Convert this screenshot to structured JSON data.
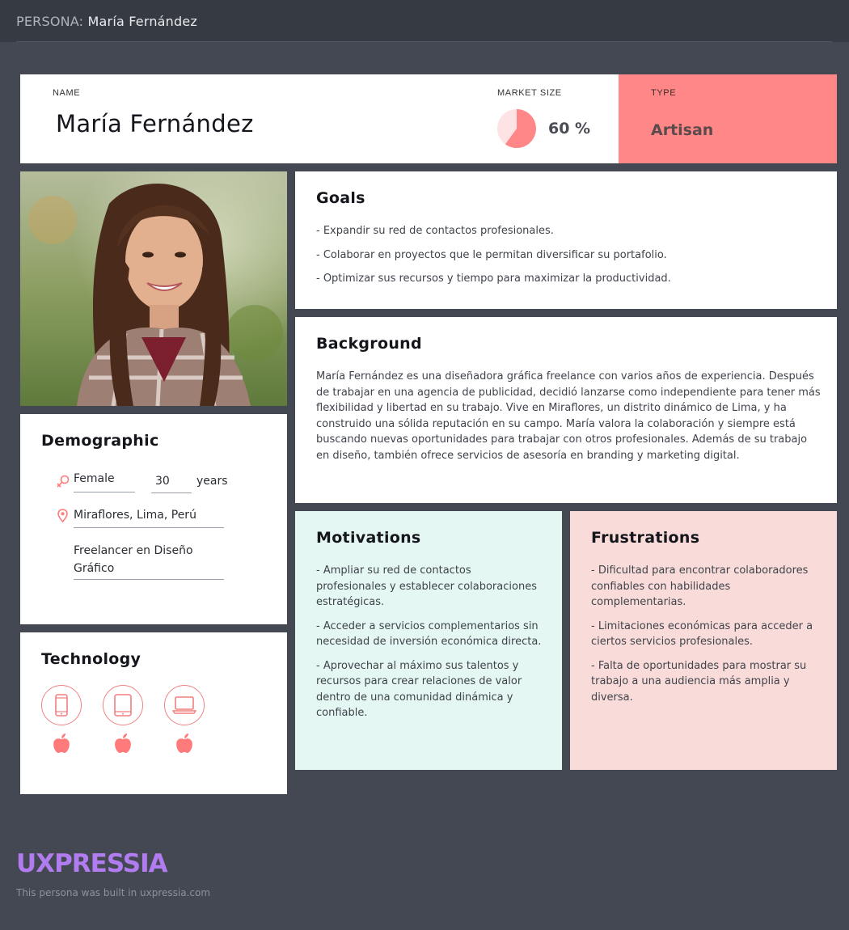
{
  "topbar": {
    "prefix": "PERSONA:",
    "name": "María Fernández"
  },
  "header": {
    "name_label": "NAME",
    "name": "María Fernández",
    "market_label": "MARKET SIZE",
    "market_value": "60 %",
    "market_fraction": 0.6,
    "type_label": "TYPE",
    "type_value": "Artisan"
  },
  "goals": {
    "title": "Goals",
    "items": [
      "- Expandir su red de contactos profesionales.",
      "- Colaborar en proyectos que le permitan diversificar su portafolio.",
      "- Optimizar sus recursos y tiempo para maximizar la productividad."
    ]
  },
  "background": {
    "title": "Background",
    "text": "María Fernández es una diseñadora gráfica freelance con varios años de experiencia. Después de trabajar en una agencia de publicidad, decidió lanzarse como independiente para tener más flexibilidad y libertad en su trabajo. Vive en Miraflores, un distrito dinámico de Lima, y ha construido una sólida reputación en su campo. María valora la colaboración y siempre está buscando nuevas oportunidades para trabajar con otros profesionales. Además de su trabajo en diseño, también ofrece servicios de asesoría en branding y marketing digital."
  },
  "demographic": {
    "title": "Demographic",
    "gender": "Female",
    "age": "30",
    "age_unit": "years",
    "location": "Miraflores, Lima, Perú",
    "occupation": "Freelancer en Diseño Gráfico"
  },
  "technology": {
    "title": "Technology",
    "devices": [
      "phone-icon",
      "tablet-icon",
      "laptop-icon"
    ],
    "platform": "apple-icon"
  },
  "motivations": {
    "title": "Motivations",
    "items": [
      "- Ampliar su red de contactos profesionales y establecer colaboraciones estratégicas.",
      "- Acceder a servicios complementarios sin necesidad de inversión económica directa.",
      "- Aprovechar al máximo sus talentos y recursos para crear relaciones de valor dentro de una comunidad dinámica y confiable."
    ]
  },
  "frustrations": {
    "title": "Frustrations",
    "items": [
      "- Dificultad para encontrar colaboradores confiables con habilidades complementarias.",
      "- Limitaciones económicas para acceder a ciertos servicios profesionales.",
      "- Falta de oportunidades para mostrar su trabajo a una audiencia más amplia y diversa."
    ]
  },
  "footer": {
    "logo": "UXPRESSIA",
    "note": "This persona was built in uxpressia.com"
  },
  "colors": {
    "accent": "#ff8787",
    "motivations_bg": "#e4f7f3",
    "frustrations_bg": "#f9dcd9",
    "logo": "#b07cf0"
  }
}
